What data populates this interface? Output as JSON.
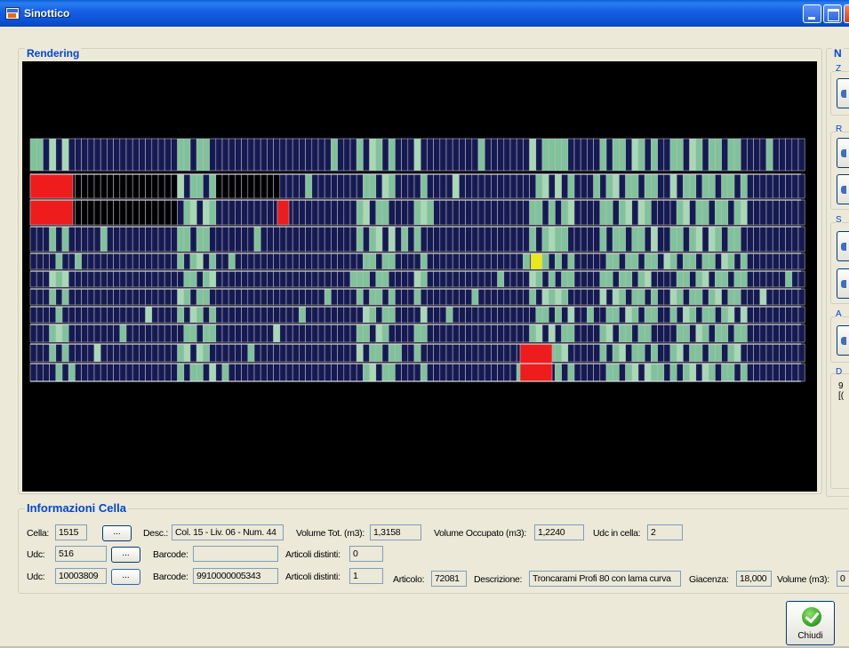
{
  "window": {
    "title": "Sinottico"
  },
  "rendering": {
    "title": "Rendering"
  },
  "right_panel": {
    "title": "N",
    "groups": [
      "Z",
      "R",
      "S",
      "A",
      "D"
    ],
    "partial_text": [
      "9",
      "[("
    ]
  },
  "info": {
    "title": "Informazioni Cella",
    "row1": {
      "cella_label": "Cella:",
      "cella_value": "1515",
      "dots": "...",
      "desc_label": "Desc.:",
      "desc_value": "Col. 15 - Liv. 06 - Num. 44",
      "vol_tot_label": "Volume Tot. (m3):",
      "vol_tot_value": "1,3158",
      "vol_occ_label": "Volume Occupato (m3):",
      "vol_occ_value": "1,2240",
      "udc_cella_label": "Udc in cella:",
      "udc_cella_value": "2"
    },
    "row2": {
      "udc_label": "Udc:",
      "udc_value": "516",
      "dots": "...",
      "barcode_label": "Barcode:",
      "barcode_value": "",
      "articoli_label": "Articoli distinti:",
      "articoli_value": "0"
    },
    "row3": {
      "udc_label": "Udc:",
      "udc_value": "10003809",
      "dots": "...",
      "barcode_label": "Barcode:",
      "barcode_value": "9910000005343",
      "articoli_label": "Articoli distinti:",
      "articoli_value": "1",
      "articolo_label": "Articolo:",
      "articolo_value": "72081",
      "descrizione_label": "Descrizione:",
      "descrizione_value": "Troncarami Profi 80 con lama curva",
      "giacenza_label": "Giacenza:",
      "giacenza_value": "18,000",
      "volume_label": "Volume (m3):",
      "volume_value": "0"
    }
  },
  "buttons": {
    "chiudi": "Chiudi"
  },
  "colors": {
    "empty": "#161a52",
    "full": "#7fc398",
    "full_light": "#a7d9b3",
    "selected": "#e8e81c",
    "alert": "#ee1c1c",
    "grid": "#b8b8c8"
  }
}
